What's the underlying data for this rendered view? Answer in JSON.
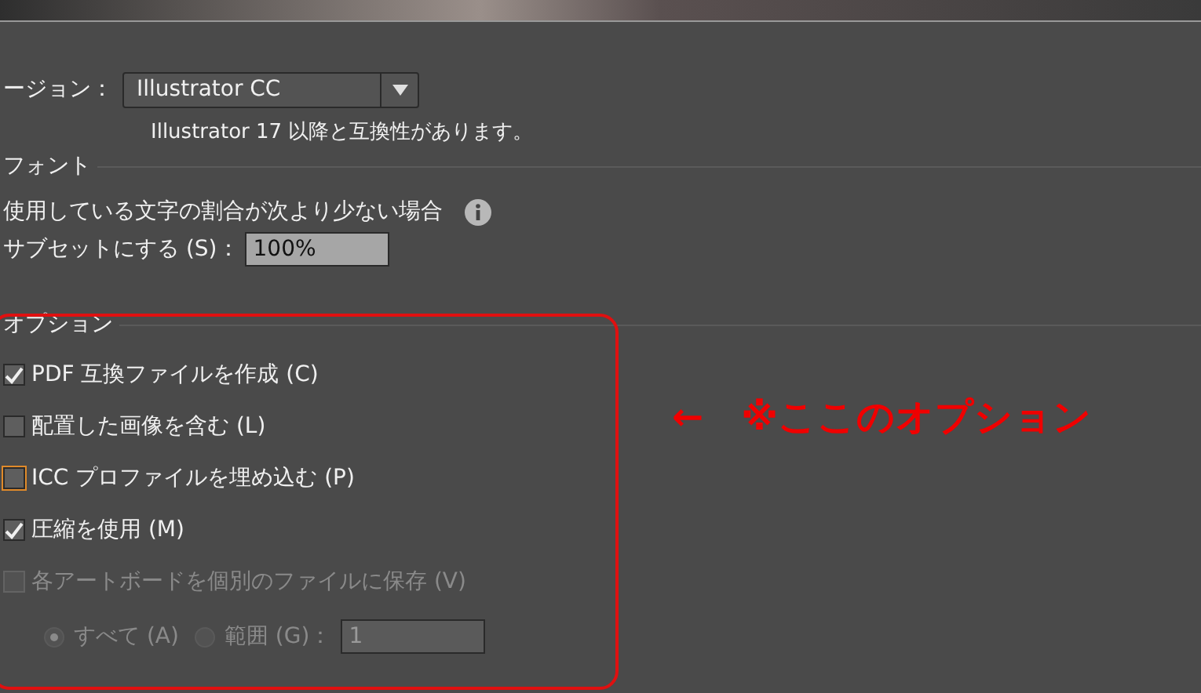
{
  "version": {
    "label": "ージョン：",
    "value": "Illustrator CC",
    "note": "Illustrator 17 以降と互換性があります。"
  },
  "font": {
    "legend": "フォント",
    "description": "使用している文字の割合が次より少ない場合",
    "subset_label": "サブセットにする (S)：",
    "subset_value": "100%"
  },
  "options": {
    "legend": "オプション",
    "items": [
      {
        "label": "PDF 互換ファイルを作成 (C)",
        "checked": true,
        "focused": false,
        "disabled": false
      },
      {
        "label": "配置した画像を含む (L)",
        "checked": false,
        "focused": false,
        "disabled": false
      },
      {
        "label": "ICC プロファイルを埋め込む (P)",
        "checked": false,
        "focused": true,
        "disabled": false
      },
      {
        "label": "圧縮を使用 (M)",
        "checked": true,
        "focused": false,
        "disabled": false
      },
      {
        "label": "各アートボードを個別のファイルに保存 (V)",
        "checked": false,
        "focused": false,
        "disabled": true
      }
    ],
    "radios": [
      {
        "label": "すべて (A)",
        "selected": true,
        "disabled": true
      },
      {
        "label": "範囲 (G)：",
        "selected": false,
        "disabled": true
      }
    ],
    "range_value": "1"
  },
  "annotation": {
    "arrow": "←",
    "text": "※ここのオプション"
  }
}
